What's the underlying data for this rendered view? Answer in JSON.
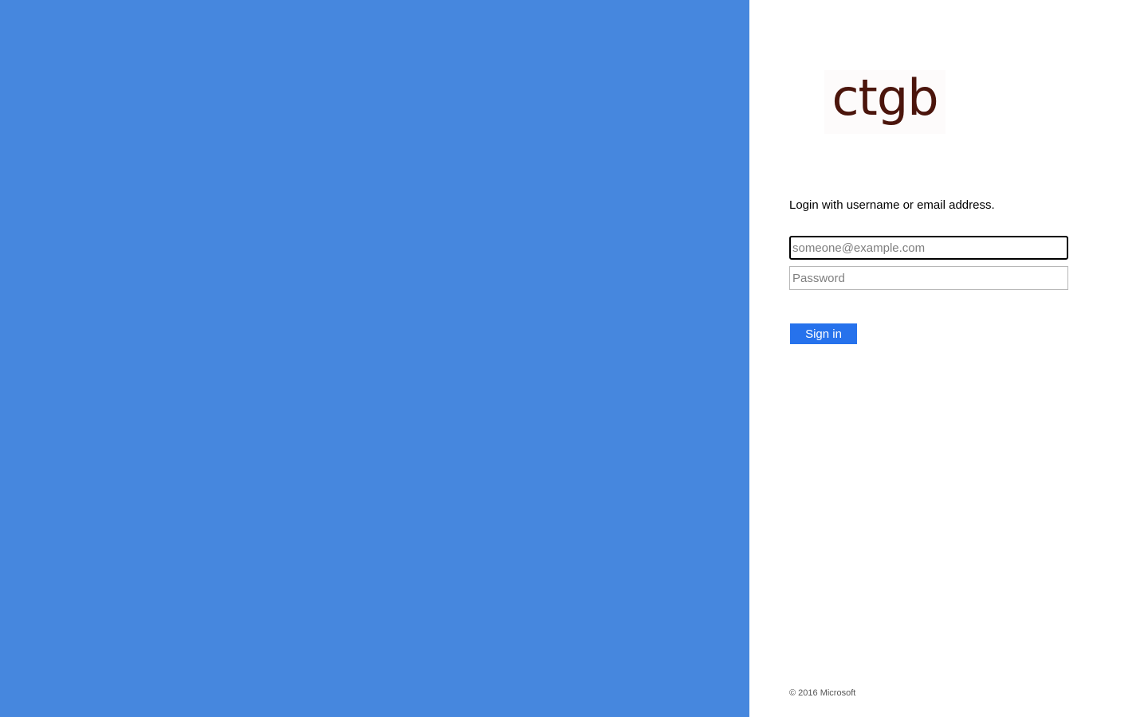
{
  "logo": {
    "text": "ctgb"
  },
  "login": {
    "prompt": "Login with username or email address.",
    "email_placeholder": "someone@example.com",
    "password_placeholder": "Password",
    "signin_label": "Sign in"
  },
  "footer": {
    "copyright": "© 2016 Microsoft"
  },
  "colors": {
    "illustration_background": "#4687de",
    "accent": "#2672ec",
    "logo_text": "#4b150c"
  }
}
